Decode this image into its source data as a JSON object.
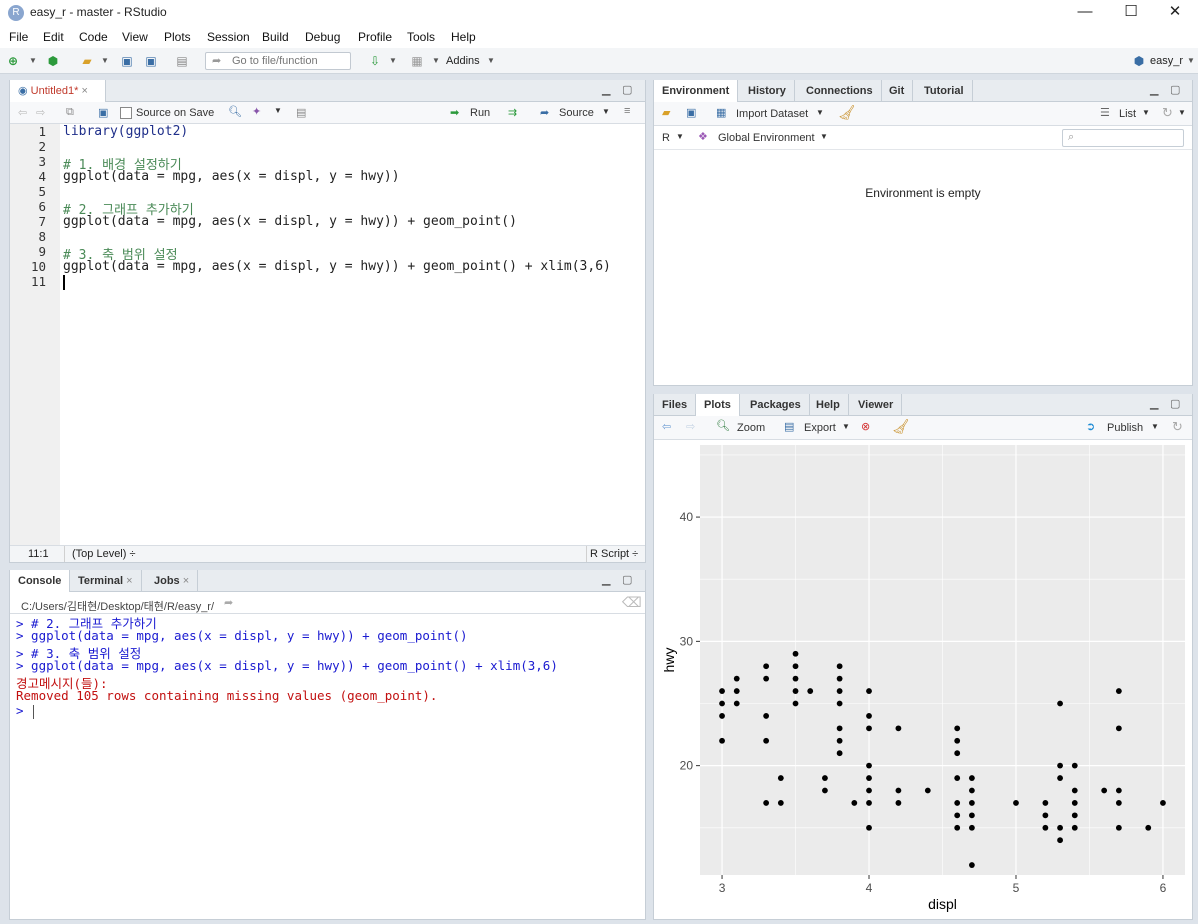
{
  "window": {
    "title": "easy_r - master - RStudio",
    "controls": [
      "—",
      "☐",
      "✕"
    ]
  },
  "menu": [
    "File",
    "Edit",
    "Code",
    "View",
    "Plots",
    "Session",
    "Build",
    "Debug",
    "Profile",
    "Tools",
    "Help"
  ],
  "toolbar": {
    "goto_placeholder": "Go to file/function",
    "addins_label": "Addins",
    "project_label": "easy_r"
  },
  "editor": {
    "tab_label": "Untitled1*",
    "source_on_save_label": "Source on Save",
    "run_label": "Run",
    "source_label": "Source",
    "line_numbers": [
      "1",
      "2",
      "3",
      "4",
      "5",
      "6",
      "7",
      "8",
      "9",
      "10",
      "11"
    ],
    "lines": [
      "library(ggplot2)",
      "",
      "# 1. 배경 설정하기",
      "ggplot(data = mpg, aes(x = displ, y = hwy))",
      "",
      "# 2. 그래프 추가하기",
      "ggplot(data = mpg, aes(x = displ, y = hwy)) + geom_point()",
      "",
      "# 3. 축 범위 설정",
      "ggplot(data = mpg, aes(x = displ, y = hwy)) + geom_point() + xlim(3,6)",
      ""
    ],
    "status_position": "11:1",
    "status_scope": "(Top Level) ÷",
    "status_type": "R Script ÷"
  },
  "console": {
    "tabs": [
      "Console",
      "Terminal",
      "Jobs"
    ],
    "path": "C:/Users/김태현/Desktop/태현/R/easy_r/",
    "lines": [
      {
        "text": "> # 2. 그래프 추가하기",
        "kind": "input"
      },
      {
        "text": "> ggplot(data = mpg, aes(x = displ, y = hwy)) + geom_point()",
        "kind": "input"
      },
      {
        "text": "> # 3. 축 범위 설정",
        "kind": "input"
      },
      {
        "text": "> ggplot(data = mpg, aes(x = displ, y = hwy)) + geom_point() + xlim(3,6)",
        "kind": "input"
      },
      {
        "text": "경고메시지(들):",
        "kind": "error"
      },
      {
        "text": "Removed 105 rows containing missing values (geom_point).",
        "kind": "error"
      },
      {
        "text": "> ",
        "kind": "input"
      }
    ]
  },
  "environment": {
    "tabs": [
      "Environment",
      "History",
      "Connections",
      "Git",
      "Tutorial"
    ],
    "import_label": "Import Dataset",
    "list_label": "List",
    "lang_label": "R",
    "scope_label": "Global Environment",
    "empty_message": "Environment is empty"
  },
  "files_pane": {
    "tabs": [
      "Files",
      "Plots",
      "Packages",
      "Help",
      "Viewer"
    ],
    "zoom_label": "Zoom",
    "export_label": "Export",
    "publish_label": "Publish"
  },
  "chart_data": {
    "type": "scatter",
    "xlabel": "displ",
    "ylabel": "hwy",
    "xlim": [
      2.85,
      6.15
    ],
    "ylim": [
      11.2,
      45.8
    ],
    "x_ticks": [
      3,
      4,
      5,
      6
    ],
    "y_ticks": [
      20,
      30,
      40
    ],
    "grid": true,
    "colors": {
      "panel": "#ebebeb",
      "point": "#000000",
      "grid": "#ffffff"
    },
    "points": [
      [
        3.0,
        26
      ],
      [
        3.0,
        25
      ],
      [
        3.0,
        24
      ],
      [
        3.0,
        22
      ],
      [
        3.1,
        27
      ],
      [
        3.1,
        26
      ],
      [
        3.1,
        25
      ],
      [
        3.3,
        28
      ],
      [
        3.3,
        27
      ],
      [
        3.3,
        24
      ],
      [
        3.3,
        22
      ],
      [
        3.3,
        17
      ],
      [
        3.4,
        19
      ],
      [
        3.4,
        17
      ],
      [
        3.5,
        29
      ],
      [
        3.5,
        28
      ],
      [
        3.5,
        27
      ],
      [
        3.5,
        26
      ],
      [
        3.5,
        25
      ],
      [
        3.6,
        26
      ],
      [
        3.7,
        19
      ],
      [
        3.7,
        18
      ],
      [
        3.8,
        28
      ],
      [
        3.8,
        27
      ],
      [
        3.8,
        26
      ],
      [
        3.8,
        25
      ],
      [
        3.8,
        23
      ],
      [
        3.8,
        22
      ],
      [
        3.8,
        21
      ],
      [
        3.9,
        17
      ],
      [
        4.0,
        26
      ],
      [
        4.0,
        24
      ],
      [
        4.0,
        23
      ],
      [
        4.0,
        20
      ],
      [
        4.0,
        19
      ],
      [
        4.0,
        18
      ],
      [
        4.0,
        17
      ],
      [
        4.0,
        15
      ],
      [
        4.2,
        23
      ],
      [
        4.2,
        18
      ],
      [
        4.2,
        17
      ],
      [
        4.4,
        18
      ],
      [
        4.6,
        23
      ],
      [
        4.6,
        22
      ],
      [
        4.6,
        21
      ],
      [
        4.6,
        19
      ],
      [
        4.6,
        17
      ],
      [
        4.6,
        16
      ],
      [
        4.6,
        15
      ],
      [
        4.7,
        19
      ],
      [
        4.7,
        18
      ],
      [
        4.7,
        17
      ],
      [
        4.7,
        16
      ],
      [
        4.7,
        15
      ],
      [
        4.7,
        12
      ],
      [
        5.0,
        17
      ],
      [
        5.2,
        17
      ],
      [
        5.2,
        16
      ],
      [
        5.2,
        15
      ],
      [
        5.3,
        25
      ],
      [
        5.3,
        20
      ],
      [
        5.3,
        19
      ],
      [
        5.3,
        15
      ],
      [
        5.3,
        14
      ],
      [
        5.4,
        20
      ],
      [
        5.4,
        18
      ],
      [
        5.4,
        17
      ],
      [
        5.4,
        16
      ],
      [
        5.4,
        15
      ],
      [
        5.6,
        18
      ],
      [
        5.7,
        26
      ],
      [
        5.7,
        23
      ],
      [
        5.7,
        18
      ],
      [
        5.7,
        17
      ],
      [
        5.7,
        15
      ],
      [
        5.9,
        15
      ],
      [
        6.0,
        17
      ]
    ]
  }
}
